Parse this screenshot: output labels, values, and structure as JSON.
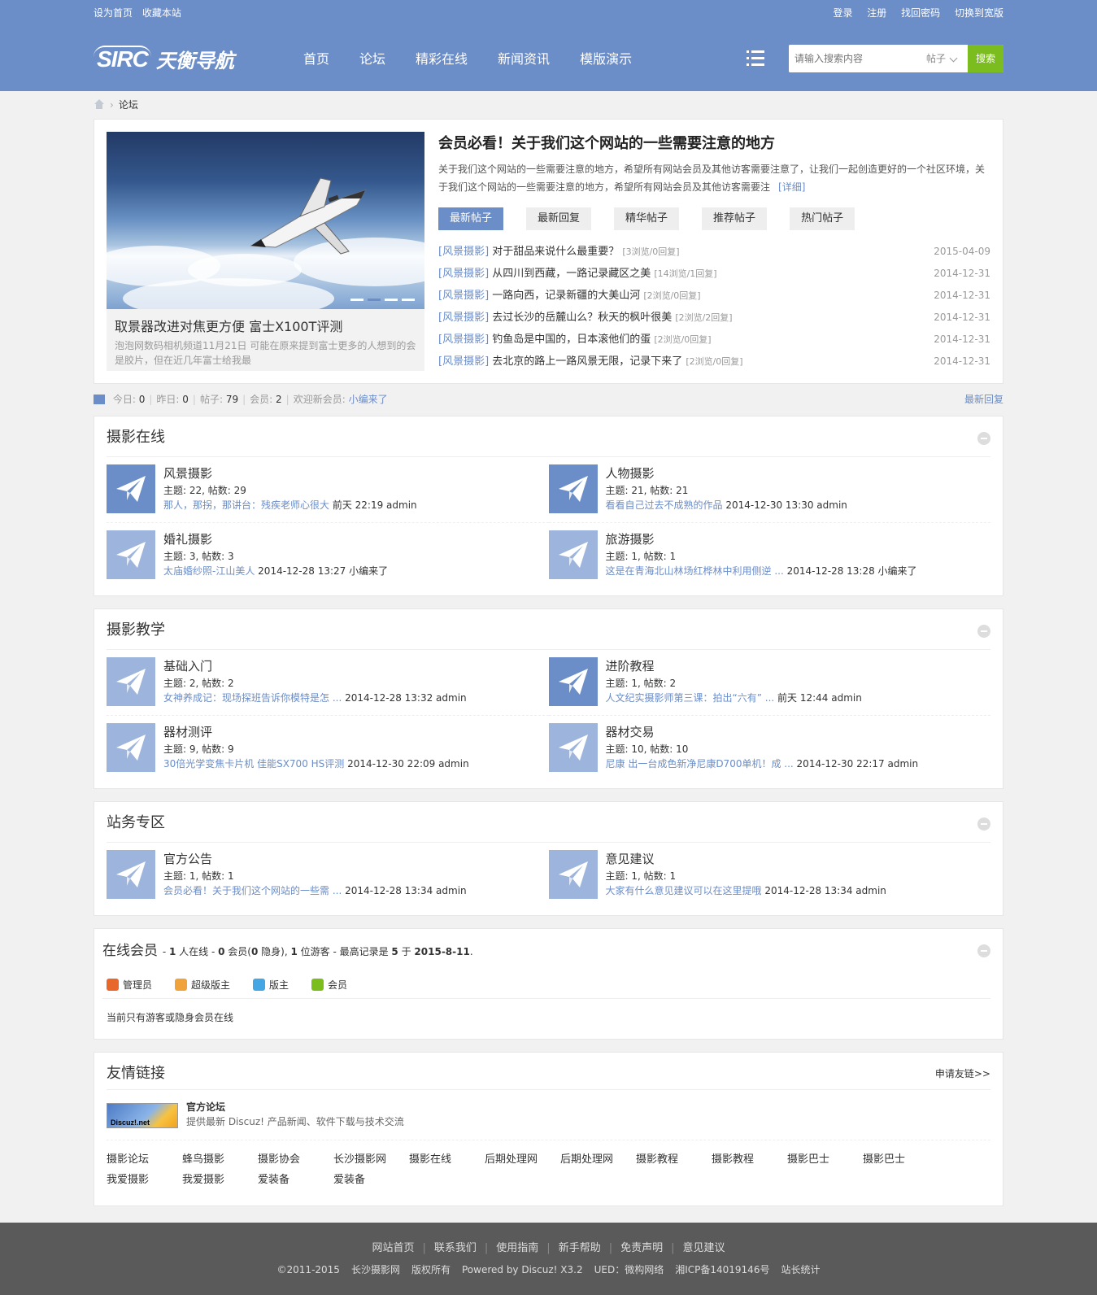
{
  "topbar": {
    "set_home": "设为首页",
    "bookmark": "收藏本站",
    "login": "登录",
    "register": "注册",
    "find_pwd": "找回密码",
    "wide": "切换到宽版"
  },
  "logo": {
    "mark": "SIRC",
    "text": "天衡导航"
  },
  "nav": [
    "首页",
    "论坛",
    "精彩在线",
    "新闻资讯",
    "模版演示"
  ],
  "search": {
    "placeholder": "请输入搜索内容",
    "type": "帖子",
    "button": "搜索"
  },
  "breadcrumb": {
    "current": "论坛"
  },
  "feature": {
    "slide_title": "取景器改进对焦更方便 富士X100T评测",
    "slide_desc": "泡泡网数码相机频道11月21日 可能在原来提到富士更多的人想到的会是胶片，但在近几年富士给我最",
    "title": "会员必看！关于我们这个网站的一些需要注意的地方",
    "desc": "关于我们这个网站的一些需要注意的地方，希望所有网站会员及其他访客需要注意了，让我们一起创造更好的一个社区环境，关于我们这个网站的一些需要注意的地方，希望所有网站会员及其他访客需要注",
    "more": "[详细]",
    "tabs": [
      "最新帖子",
      "最新回复",
      "精华帖子",
      "推荐帖子",
      "热门帖子"
    ],
    "threads": [
      {
        "cat": "[风景摄影]",
        "title": "对于甜品来说什么最重要？",
        "stat": "[3浏览/0回复]",
        "date": "2015-04-09"
      },
      {
        "cat": "[风景摄影]",
        "title": "从四川到西藏，一路记录藏区之美",
        "stat": "[14浏览/1回复]",
        "date": "2014-12-31"
      },
      {
        "cat": "[风景摄影]",
        "title": "一路向西，记录新疆的大美山河",
        "stat": "[2浏览/0回复]",
        "date": "2014-12-31"
      },
      {
        "cat": "[风景摄影]",
        "title": "去过长沙的岳麓山么？秋天的枫叶很美",
        "stat": "[2浏览/2回复]",
        "date": "2014-12-31"
      },
      {
        "cat": "[风景摄影]",
        "title": "钓鱼岛是中国的，日本滚他们的蛋",
        "stat": "[2浏览/0回复]",
        "date": "2014-12-31"
      },
      {
        "cat": "[风景摄影]",
        "title": "去北京的路上一路风景无限，记录下来了",
        "stat": "[2浏览/0回复]",
        "date": "2014-12-31"
      }
    ]
  },
  "stats": {
    "today_l": "今日:",
    "today": "0",
    "yest_l": "昨日:",
    "yest": "0",
    "posts_l": "帖子:",
    "posts": "79",
    "members_l": "会员:",
    "members": "2",
    "welcome": "欢迎新会员:",
    "newest": "小编来了",
    "latest_reply": "最新回复"
  },
  "categories": [
    {
      "title": "摄影在线",
      "forums": [
        {
          "name": "风景摄影",
          "counts": "主题: 22, 帖数: 29",
          "link": "那人，那拐，那讲台：残疾老师心很大",
          "meta": "前天 22:19 admin",
          "dark": true
        },
        {
          "name": "人物摄影",
          "counts": "主题: 21, 帖数: 21",
          "link": "看看自己过去不成熟的作品",
          "meta": "2014-12-30 13:30 admin",
          "dark": true
        },
        {
          "name": "婚礼摄影",
          "counts": "主题: 3, 帖数: 3",
          "link": "太庙婚纱照-江山美人",
          "meta": "2014-12-28 13:27 小编来了",
          "dark": false
        },
        {
          "name": "旅游摄影",
          "counts": "主题: 1, 帖数: 1",
          "link": "这是在青海北山林场红桦林中利用侧逆 ...",
          "meta": "2014-12-28 13:28 小编来了",
          "dark": false
        }
      ]
    },
    {
      "title": "摄影教学",
      "forums": [
        {
          "name": "基础入门",
          "counts": "主题: 2, 帖数: 2",
          "link": "女神养成记：现场探班告诉你模特是怎 ...",
          "meta": "2014-12-28 13:32 admin",
          "dark": false
        },
        {
          "name": "进阶教程",
          "counts": "主题: 1, 帖数: 2",
          "link": "人文纪实摄影师第三课：拍出“六有” ...",
          "meta": "前天 12:44 admin",
          "dark": true
        },
        {
          "name": "器材测评",
          "counts": "主题: 9, 帖数: 9",
          "link": "30倍光学变焦卡片机 佳能SX700 HS评测",
          "meta": "2014-12-30 22:09 admin",
          "dark": false
        },
        {
          "name": "器材交易",
          "counts": "主题: 10, 帖数: 10",
          "link": "尼康 出一台成色新净尼康D700单机！成 ...",
          "meta": "2014-12-30 22:17 admin",
          "dark": false
        }
      ]
    },
    {
      "title": "站务专区",
      "forums": [
        {
          "name": "官方公告",
          "counts": "主题: 1, 帖数: 1",
          "link": "会员必看！关于我们这个网站的一些需 ...",
          "meta": "2014-12-28 13:34 admin",
          "dark": false
        },
        {
          "name": "意见建议",
          "counts": "主题: 1, 帖数: 1",
          "link": "大家有什么意见建议可以在这里提哦",
          "meta": "2014-12-28 13:34 admin",
          "dark": false
        }
      ]
    }
  ],
  "online": {
    "title": "在线会员",
    "summary_a": " - ",
    "online_n": "1",
    "summary_b": " 人在线 - ",
    "members_n": "0",
    "summary_c": " 会员(",
    "hidden_n": "0",
    "summary_d": " 隐身), ",
    "guests_n": "1",
    "summary_e": " 位游客 - 最高记录是 ",
    "record_n": "5",
    "summary_f": " 于 ",
    "record_date": "2015-8-11",
    "summary_g": ".",
    "roles": [
      {
        "label": "管理员",
        "color": "#e8672b"
      },
      {
        "label": "超级版主",
        "color": "#f0a33a"
      },
      {
        "label": "版主",
        "color": "#45a6e4"
      },
      {
        "label": "会员",
        "color": "#7bbc1f"
      }
    ],
    "note": "当前只有游客或隐身会员在线"
  },
  "links": {
    "title": "友情链接",
    "apply": "申请友链>>",
    "main_title": "官方论坛",
    "main_desc": "提供最新 Discuz! 产品新闻、软件下载与技术交流",
    "main_logo": "Discuz!.net",
    "items": [
      "摄影论坛",
      "蜂鸟摄影",
      "摄影协会",
      "长沙摄影网",
      "摄影在线",
      "后期处理网",
      "后期处理网",
      "摄影教程",
      "摄影教程",
      "摄影巴士",
      "摄影巴士",
      "我爱摄影",
      "我爱摄影",
      "爱装备",
      "爱装备"
    ]
  },
  "footer": {
    "nav": [
      "网站首页",
      "联系我们",
      "使用指南",
      "新手帮助",
      "免责声明",
      "意见建议"
    ],
    "copy": [
      "©2011-2015",
      "长沙摄影网",
      "版权所有",
      "Powered by Discuz! X3.2",
      "UED：微构网络",
      "湘ICP备14019146号",
      "站长统计"
    ]
  },
  "colors": {
    "brand": "#6b8dc8",
    "accent": "#7bbc1f",
    "footer_bg": "#5a5a5a"
  }
}
